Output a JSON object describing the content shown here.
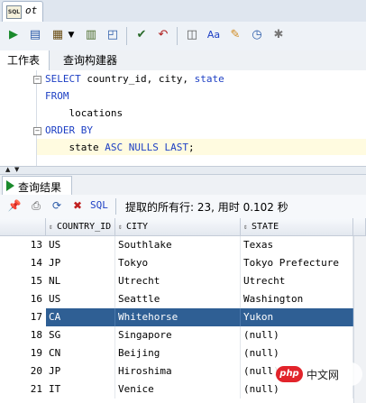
{
  "document_tab": {
    "icon": "sql-file-icon",
    "label": "ot",
    "icon_text": "SQL"
  },
  "toolbar": {
    "buttons": [
      "run-statement-icon",
      "run-script-icon",
      "autotrace-icon",
      "chevron-down-icon",
      "explain-plan-icon",
      "sql-tuning-icon",
      "commit-icon",
      "rollback-icon",
      "unshared-sql-icon",
      "to-upper-icon",
      "clear-icon",
      "history-icon",
      "settings-icon"
    ]
  },
  "subtabs": [
    {
      "label": "工作表"
    },
    {
      "label": "查询构建器"
    }
  ],
  "editor": {
    "lines": [
      {
        "parts": [
          {
            "t": "SELECT",
            "kw": true
          },
          {
            "t": " country_id, city, ",
            "kw": false
          },
          {
            "t": "state",
            "kw": true
          }
        ]
      },
      {
        "parts": [
          {
            "t": "FROM",
            "kw": true
          }
        ]
      },
      {
        "parts": [
          {
            "t": "    locations",
            "kw": false
          }
        ]
      },
      {
        "parts": [
          {
            "t": "ORDER BY",
            "kw": true
          }
        ]
      },
      {
        "parts": [
          {
            "t": "    state ",
            "kw": false
          },
          {
            "t": "ASC NULLS LAST",
            "kw": true
          },
          {
            "t": ";",
            "kw": false
          }
        ]
      }
    ]
  },
  "results": {
    "tab_label": "查询结果",
    "sql_label": "SQL",
    "fetch_message": "提取的所有行: 23, 用时 0.102 秒",
    "columns": [
      "COUNTRY_ID",
      "CITY",
      "STATE"
    ],
    "rows": [
      {
        "n": "13",
        "country_id": "US",
        "city": "Southlake",
        "state": "Texas",
        "selected": false
      },
      {
        "n": "14",
        "country_id": "JP",
        "city": "Tokyo",
        "state": "Tokyo Prefecture",
        "selected": false
      },
      {
        "n": "15",
        "country_id": "NL",
        "city": "Utrecht",
        "state": "Utrecht",
        "selected": false
      },
      {
        "n": "16",
        "country_id": "US",
        "city": "Seattle",
        "state": "Washington",
        "selected": false
      },
      {
        "n": "17",
        "country_id": "CA",
        "city": "Whitehorse",
        "state": "Yukon",
        "selected": true
      },
      {
        "n": "18",
        "country_id": "SG",
        "city": "Singapore",
        "state": "(null)",
        "selected": false
      },
      {
        "n": "19",
        "country_id": "CN",
        "city": "Beijing",
        "state": "(null)",
        "selected": false
      },
      {
        "n": "20",
        "country_id": "JP",
        "city": "Hiroshima",
        "state": "(null)",
        "selected": false
      },
      {
        "n": "21",
        "country_id": "IT",
        "city": "Venice",
        "state": "(null)",
        "selected": false
      }
    ]
  },
  "watermark": {
    "logo_text": "php",
    "text": "中文网"
  },
  "colors": {
    "keyword": "#1d3fc4",
    "selection": "#2f5f94",
    "current_line": "#fffbe0"
  }
}
